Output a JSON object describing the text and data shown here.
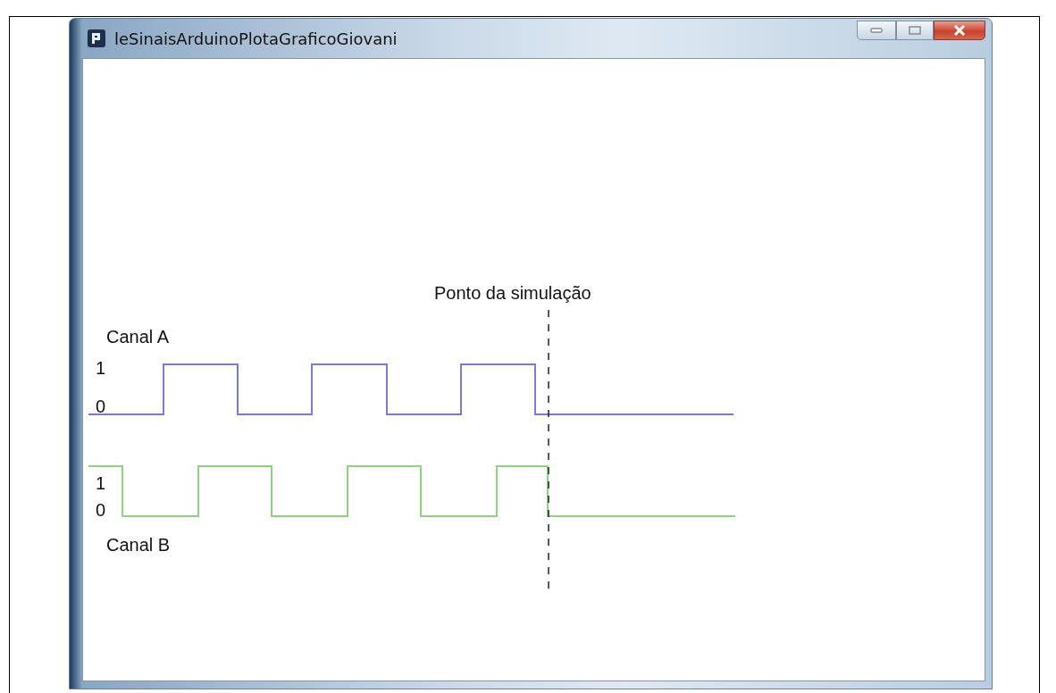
{
  "window": {
    "title": "leSinaisArduinoPlotaGraficoGiovani"
  },
  "marker": {
    "label": "Ponto da simulação"
  },
  "channels": [
    {
      "name": "Canal A",
      "high_label": "1",
      "low_label": "0",
      "color": "#7a7ad8"
    },
    {
      "name": "Canal B",
      "high_label": "1",
      "low_label": "0",
      "color": "#8fd27f"
    }
  ]
}
